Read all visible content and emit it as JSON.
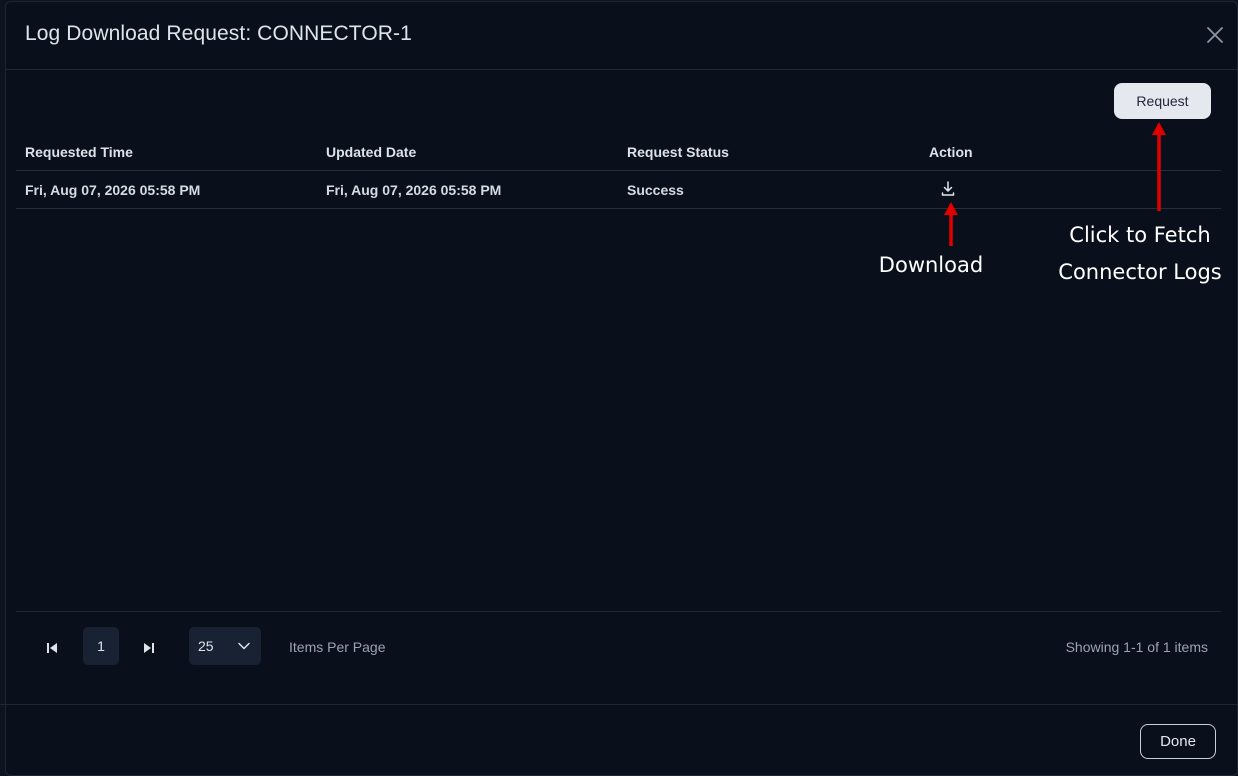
{
  "dialog": {
    "title": "Log Download Request: CONNECTOR-1",
    "close_icon": "close-icon"
  },
  "toolbar": {
    "request_label": "Request"
  },
  "table": {
    "columns": [
      "Requested Time",
      "Updated Date",
      "Request Status",
      "Action"
    ],
    "rows": [
      {
        "requested_time": "Fri, Aug 07, 2026 05:58 PM",
        "updated_date": "Fri, Aug 07, 2026 05:58 PM",
        "status": "Success",
        "action_icon": "download-icon"
      }
    ]
  },
  "pagination": {
    "current_page": "1",
    "per_page": "25",
    "items_per_page_label": "Items Per Page",
    "showing": "Showing 1-1 of 1 items"
  },
  "footer": {
    "done_label": "Done"
  },
  "annotations": {
    "download": "Download",
    "request_line1": "Click to Fetch",
    "request_line2": "Connector Logs",
    "arrow_color": "#e00000"
  },
  "colors": {
    "background": "#0a101b",
    "request_button_bg": "#e6e8f0",
    "pager_bg": "#182232"
  }
}
